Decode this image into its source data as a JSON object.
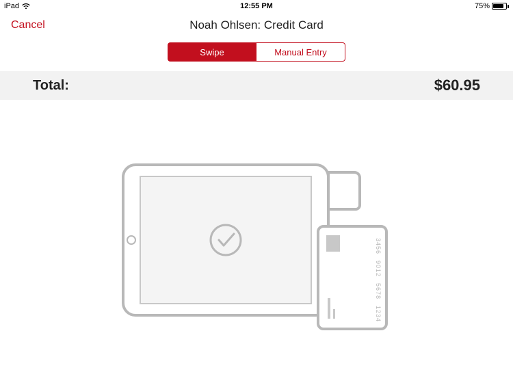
{
  "status": {
    "device": "iPad",
    "time": "12:55 PM",
    "battery_pct": "75%"
  },
  "nav": {
    "cancel": "Cancel",
    "title": "Noah Ohlsen: Credit Card"
  },
  "segmented": {
    "swipe": "Swipe",
    "manual": "Manual Entry"
  },
  "total": {
    "label": "Total:",
    "amount": "$60.95"
  },
  "card": {
    "line1": "1234  5678  9012  3456",
    "line2": "1234 5678 9012 3456"
  }
}
